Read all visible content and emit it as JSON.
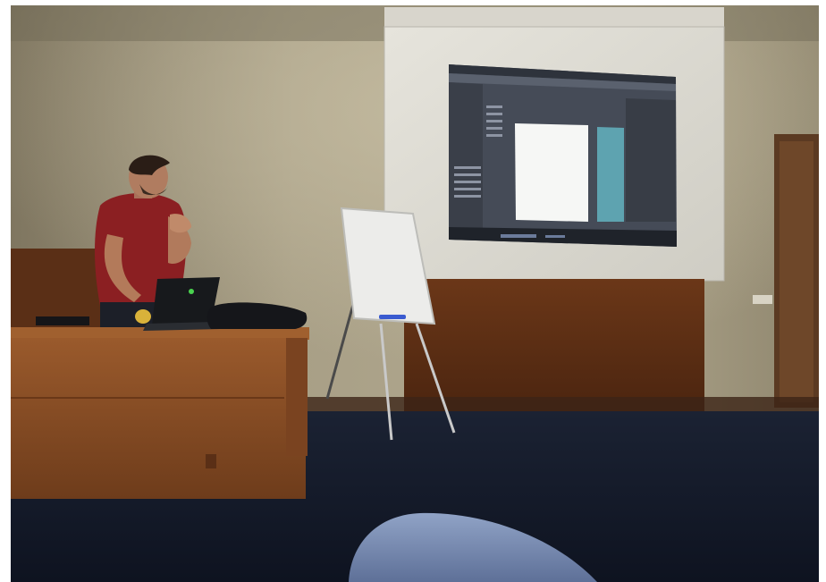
{
  "scene": {
    "colors": {
      "wall": "#9b927a",
      "wall_light": "#c0b79c",
      "projection": "#dcdad2",
      "ui_dark": "#3f4550",
      "canvas_white": "#f4f6f4",
      "panel_teal": "#5aa1ae",
      "desk_wood": "#8a4f25",
      "wood_panel": "#5a2e14",
      "floor": "#141a28",
      "shirt": "#8a1f21",
      "jeans": "#7a8fb4"
    },
    "icons": [
      "laptop-icon",
      "marker-icon",
      "status-led-icon"
    ]
  }
}
